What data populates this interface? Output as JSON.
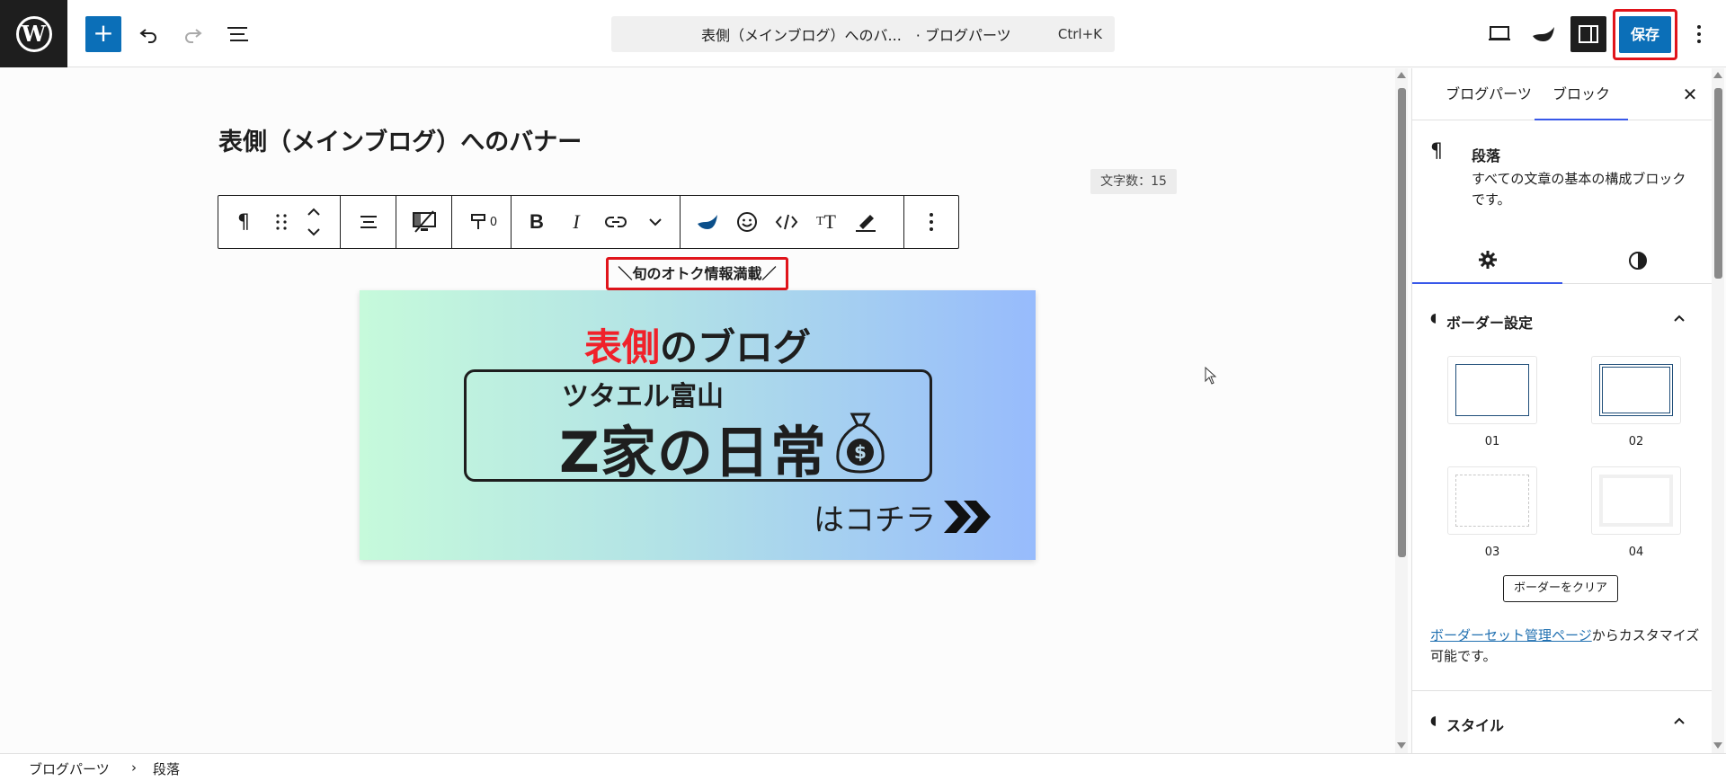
{
  "topbar": {
    "command": {
      "title": "表側（メインブログ）へのバ...",
      "context": "· ブログパーツ",
      "shortcut": "Ctrl+K"
    },
    "save_label": "保存"
  },
  "editor": {
    "title": "表側（メインブログ）へのバナー",
    "word_count": "文字数：15",
    "style_count": "0",
    "caption": "＼旬のオトク情報満載／"
  },
  "banner": {
    "headline_accent": "表側",
    "headline_rest": "のブログ",
    "subtitle": "ツタエル富山",
    "main": "Z家の日常",
    "cta": "はコチラ",
    "accent_color": "#f0212a"
  },
  "sidebar": {
    "tabs": [
      {
        "label": "ブログパーツ"
      },
      {
        "label": "ブロック"
      }
    ],
    "block": {
      "name": "段落",
      "description": "すべての文章の基本の構成ブロックです。"
    },
    "border_panel": {
      "title": "ボーダー設定",
      "options": [
        {
          "label": "01"
        },
        {
          "label": "02"
        },
        {
          "label": "03"
        },
        {
          "label": "04"
        }
      ],
      "clear_label": "ボーダーをクリア",
      "link_text": "ボーダーセット管理ページ",
      "link_suffix": "からカスタマイズ可能です。"
    },
    "style_panel": {
      "title": "スタイル"
    }
  },
  "breadcrumb": {
    "items": [
      {
        "label": "ブログパーツ"
      },
      {
        "label": "段落"
      }
    ]
  },
  "colors": {
    "primary": "#0b6fb8",
    "highlight": "#e0141b",
    "tab_active": "#3858e9"
  }
}
